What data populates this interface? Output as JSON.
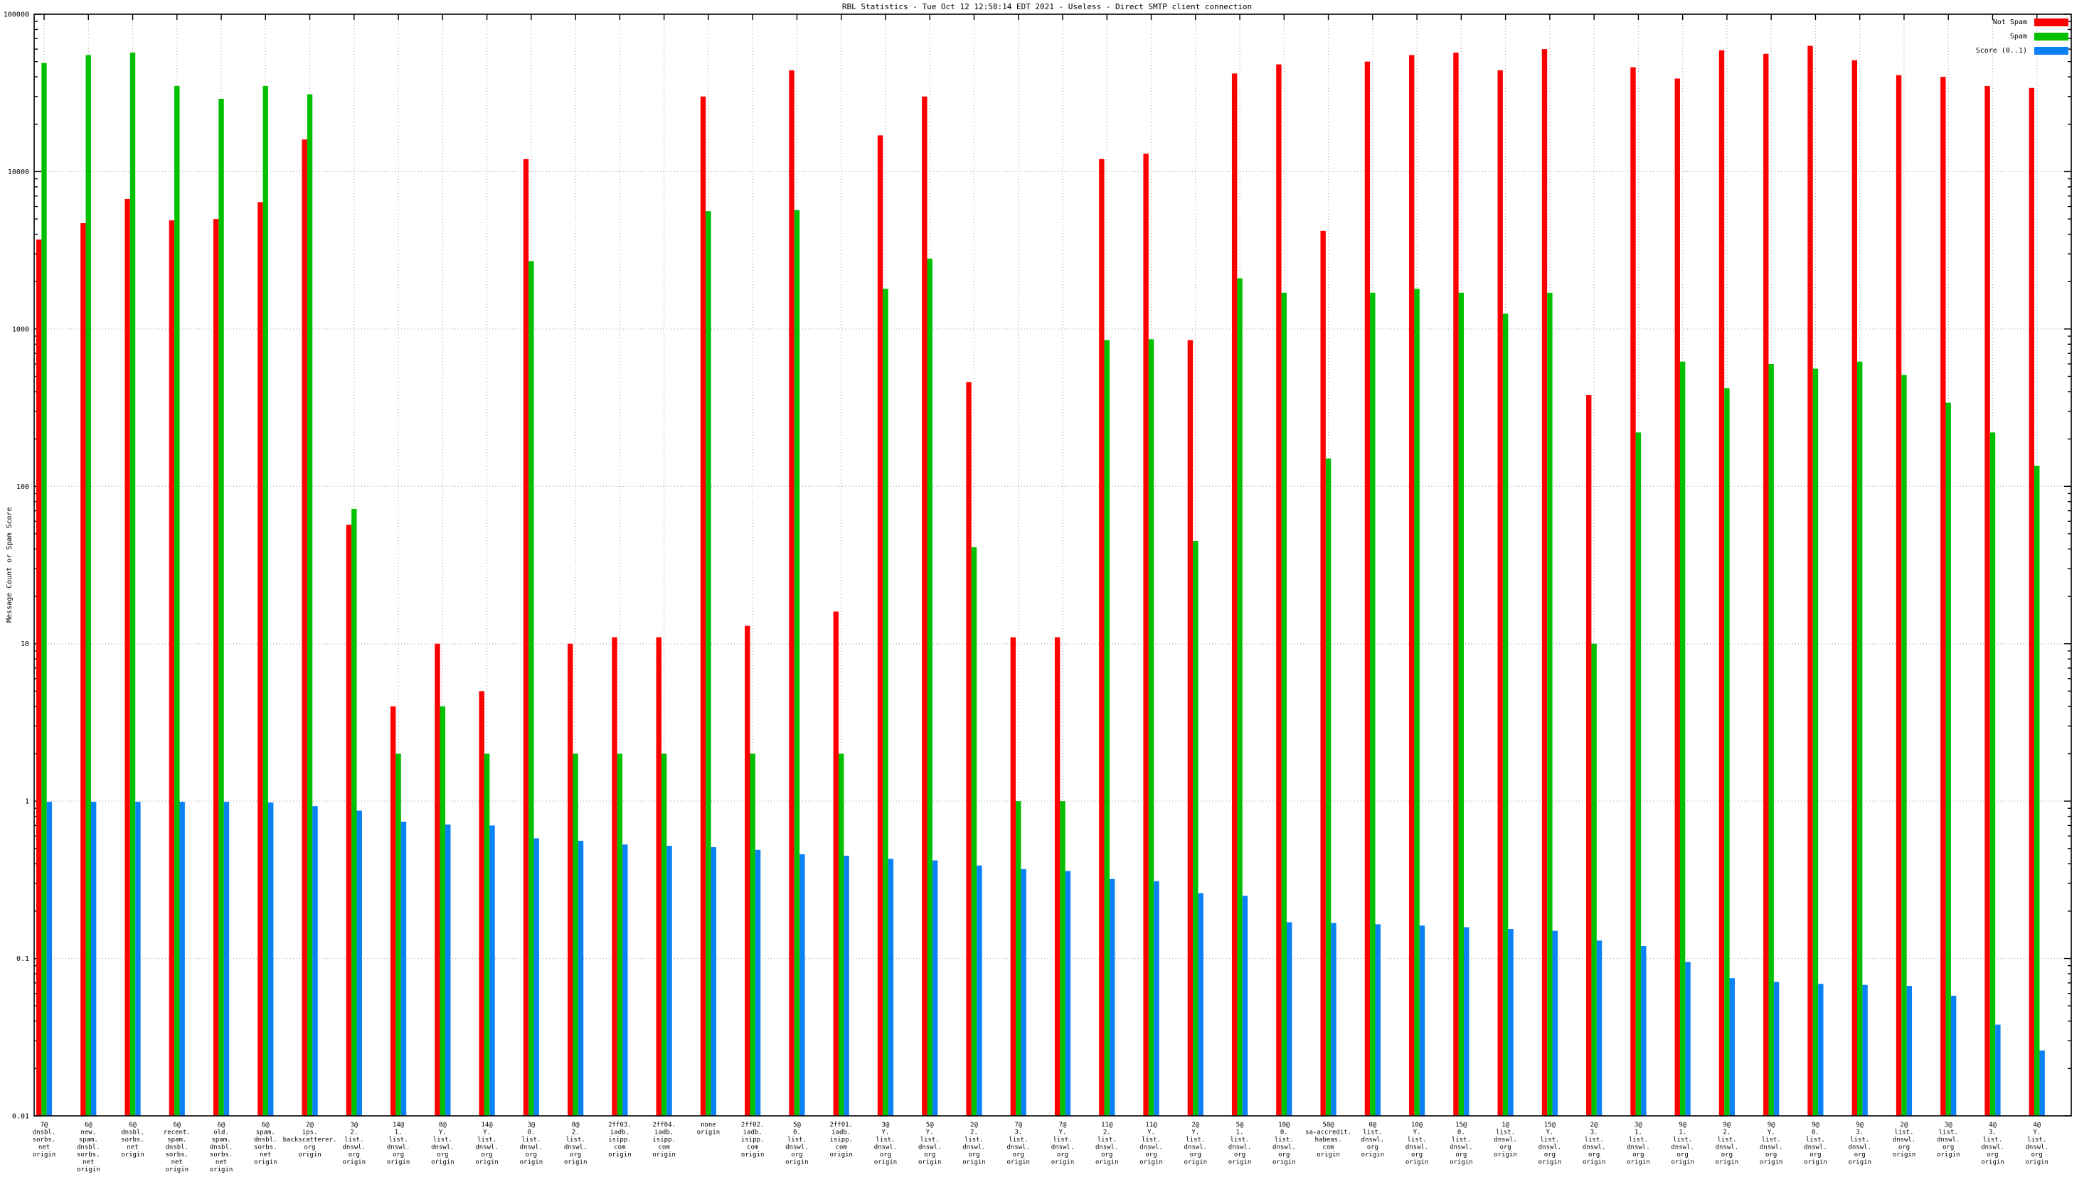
{
  "title": "RBL Statistics - Tue Oct 12 12:58:14 EDT 2021 - Useless - Direct SMTP client connection",
  "chart_data": {
    "type": "bar",
    "title": "RBL Statistics - Tue Oct 12 12:58:14 EDT 2021 - Useless - Direct SMTP client connection",
    "xlabel": "",
    "ylabel": "Message Count or Spam Score",
    "y_scale": "log",
    "ylim": [
      0.01,
      100000
    ],
    "y_ticks": [
      "100000",
      "10000",
      "1000",
      "100",
      "10",
      "1",
      "0.1",
      "0.01"
    ],
    "grid": true,
    "legend_position": "top-right",
    "grid_color": "#b0b0b0",
    "border_color": "#000000",
    "series_meta": [
      {
        "name": "Not Spam",
        "color": "#ff0000"
      },
      {
        "name": "Spam",
        "color": "#00c000"
      },
      {
        "name": "Score (0..1)",
        "color": "#0a82f5"
      }
    ],
    "categories": [
      [
        "7@",
        "dnsbl.",
        "sorbs.",
        "net",
        "origin"
      ],
      [
        "6@",
        "new.",
        "spam.",
        "dnsbl.",
        "sorbs.",
        "net",
        "origin"
      ],
      [
        "6@",
        "dnsbl.",
        "sorbs.",
        "net",
        "origin"
      ],
      [
        "6@",
        "recent.",
        "spam.",
        "dnsbl.",
        "sorbs.",
        "net",
        "origin"
      ],
      [
        "6@",
        "old.",
        "spam.",
        "dnsbl.",
        "sorbs.",
        "net",
        "origin"
      ],
      [
        "6@",
        "spam.",
        "dnsbl.",
        "sorbs.",
        "net",
        "origin"
      ],
      [
        "2@",
        "ips.",
        "backscatterer.",
        "org",
        "origin"
      ],
      [
        "3@",
        "2.",
        "list.",
        "dnswl.",
        "org",
        "origin"
      ],
      [
        "14@",
        "1.",
        "list.",
        "dnswl.",
        "org",
        "origin"
      ],
      [
        "8@",
        "Y.",
        "list.",
        "dnswl.",
        "org",
        "origin"
      ],
      [
        "14@",
        "Y.",
        "list.",
        "dnswl.",
        "org",
        "origin"
      ],
      [
        "3@",
        "0.",
        "list.",
        "dnswl.",
        "org",
        "origin"
      ],
      [
        "8@",
        "2.",
        "list.",
        "dnswl.",
        "org",
        "origin"
      ],
      [
        "2ff03.",
        "iadb.",
        "isipp.",
        "com",
        "origin"
      ],
      [
        "2ff04.",
        "iadb.",
        "isipp.",
        "com",
        "origin"
      ],
      [
        "none",
        "origin"
      ],
      [
        "2ff02.",
        "iadb.",
        "isipp.",
        "com",
        "origin"
      ],
      [
        "5@",
        "0.",
        "list.",
        "dnswl.",
        "org",
        "origin"
      ],
      [
        "2ff01.",
        "iadb.",
        "isipp.",
        "com",
        "origin"
      ],
      [
        "3@",
        "Y.",
        "list.",
        "dnswl.",
        "org",
        "origin"
      ],
      [
        "5@",
        "Y.",
        "list.",
        "dnswl.",
        "org",
        "origin"
      ],
      [
        "2@",
        "2.",
        "list.",
        "dnswl.",
        "org",
        "origin"
      ],
      [
        "7@",
        "3.",
        "list.",
        "dnswl.",
        "org",
        "origin"
      ],
      [
        "7@",
        "Y.",
        "list.",
        "dnswl.",
        "org",
        "origin"
      ],
      [
        "11@",
        "2.",
        "list.",
        "dnswl.",
        "org",
        "origin"
      ],
      [
        "11@",
        "Y.",
        "list.",
        "dnswl.",
        "org",
        "origin"
      ],
      [
        "2@",
        "Y.",
        "list.",
        "dnswl.",
        "org",
        "origin"
      ],
      [
        "5@",
        "1.",
        "list.",
        "dnswl.",
        "org",
        "origin"
      ],
      [
        "10@",
        "0.",
        "list.",
        "dnswl.",
        "org",
        "origin"
      ],
      [
        "50@",
        "sa-accredit.",
        "habeas.",
        "com",
        "origin"
      ],
      [
        "0@",
        "list.",
        "dnswl.",
        "org",
        "origin"
      ],
      [
        "10@",
        "Y.",
        "list.",
        "dnswl.",
        "org",
        "origin"
      ],
      [
        "15@",
        "0.",
        "list.",
        "dnswl.",
        "org",
        "origin"
      ],
      [
        "1@",
        "list.",
        "dnswl.",
        "org",
        "origin"
      ],
      [
        "15@",
        "Y.",
        "list.",
        "dnswl.",
        "org",
        "origin"
      ],
      [
        "2@",
        "3.",
        "list.",
        "dnswl.",
        "org",
        "origin"
      ],
      [
        "3@",
        "1.",
        "list.",
        "dnswl.",
        "org",
        "origin"
      ],
      [
        "9@",
        "1.",
        "list.",
        "dnswl.",
        "org",
        "origin"
      ],
      [
        "9@",
        "2.",
        "list.",
        "dnswl.",
        "org",
        "origin"
      ],
      [
        "9@",
        "Y.",
        "list.",
        "dnswl.",
        "org",
        "origin"
      ],
      [
        "9@",
        "0.",
        "list.",
        "dnswl.",
        "org",
        "origin"
      ],
      [
        "9@",
        "3.",
        "list.",
        "dnswl.",
        "org",
        "origin"
      ],
      [
        "2@",
        "list.",
        "dnswl.",
        "org",
        "origin"
      ],
      [
        "3@",
        "list.",
        "dnswl.",
        "org",
        "origin"
      ],
      [
        "4@",
        "3.",
        "list.",
        "dnswl.",
        "org",
        "origin"
      ],
      [
        "4@",
        "Y.",
        "list.",
        "dnswl.",
        "org",
        "origin"
      ]
    ],
    "series": [
      {
        "name": "Not Spam",
        "values": [
          3700,
          4700,
          6700,
          4900,
          5000,
          6400,
          16000,
          57,
          4,
          10,
          5,
          12000,
          10,
          11,
          11,
          30000,
          13,
          44000,
          16,
          17000,
          30000,
          460,
          11,
          11,
          12000,
          13000,
          850,
          42000,
          48000,
          4200,
          50000,
          55000,
          57000,
          44000,
          60000,
          380,
          46000,
          39000,
          59000,
          56000,
          63000,
          51000,
          41000,
          40000,
          35000,
          34000
        ]
      },
      {
        "name": "Spam",
        "values": [
          49000,
          55000,
          57000,
          35000,
          29000,
          35000,
          31000,
          72,
          2,
          4,
          2,
          2700,
          2,
          2,
          2,
          5600,
          2,
          5700,
          2,
          1800,
          2800,
          41,
          1,
          1,
          850,
          860,
          45,
          2100,
          1700,
          150,
          1700,
          1800,
          1700,
          1250,
          1700,
          10,
          220,
          620,
          420,
          600,
          560,
          620,
          510,
          340,
          220,
          135
        ]
      },
      {
        "name": "Score (0..1)",
        "values": [
          0.99,
          0.99,
          0.99,
          0.99,
          0.99,
          0.98,
          0.93,
          0.87,
          0.74,
          0.71,
          0.7,
          0.58,
          0.56,
          0.53,
          0.52,
          0.51,
          0.49,
          0.46,
          0.45,
          0.43,
          0.42,
          0.39,
          0.37,
          0.36,
          0.32,
          0.31,
          0.26,
          0.25,
          0.17,
          0.168,
          0.165,
          0.162,
          0.158,
          0.154,
          0.15,
          0.13,
          0.12,
          0.095,
          0.075,
          0.071,
          0.069,
          0.068,
          0.067,
          0.058,
          0.038,
          0.026
        ]
      }
    ]
  },
  "legend": {
    "not_spam_label": "Not Spam",
    "spam_label": "Spam",
    "score_label": "Score (0..1)"
  }
}
